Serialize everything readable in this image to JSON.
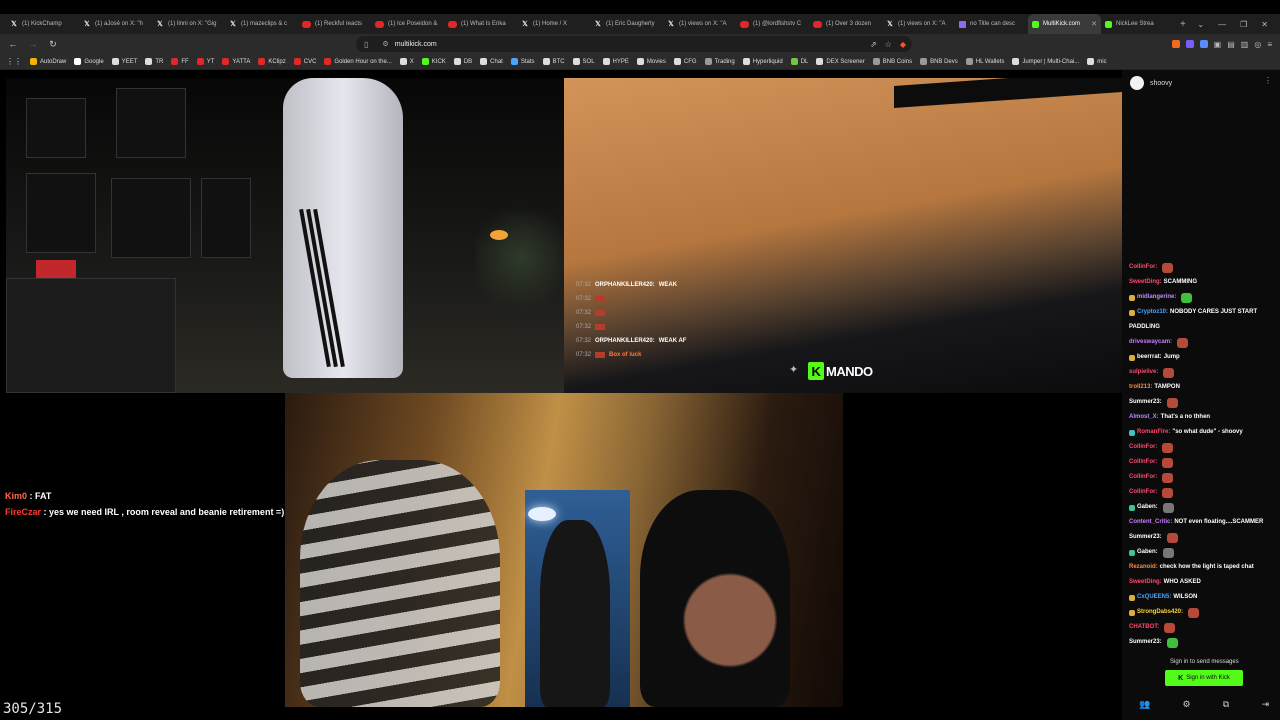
{
  "tabs": [
    {
      "icon": "x-icon",
      "label": "(1) KickChamp"
    },
    {
      "icon": "x-icon",
      "label": "(1) aJosé on X: \"h"
    },
    {
      "icon": "x-icon",
      "label": "(1) linni on X: \"Gig"
    },
    {
      "icon": "x-icon",
      "label": "(1) mazeclips & c"
    },
    {
      "icon": "youtube-icon",
      "label": "(1) Reckful reacts"
    },
    {
      "icon": "youtube-icon",
      "label": "(1) Ice Poseidon &"
    },
    {
      "icon": "youtube-icon",
      "label": "(1) What Is Erika"
    },
    {
      "icon": "x-icon",
      "label": "(1) Home / X"
    },
    {
      "icon": "x-icon",
      "label": "(1) Eric Daugherty"
    },
    {
      "icon": "x-icon",
      "label": "(1) views on X: \"A"
    },
    {
      "icon": "youtube-icon",
      "label": "(1) @lordfishstv C"
    },
    {
      "icon": "youtube-icon",
      "label": "(1) Over 3 dozen"
    },
    {
      "icon": "x-icon",
      "label": "(1) views on X: \"A"
    },
    {
      "icon": "doc-icon",
      "label": "no Title can desc"
    },
    {
      "icon": "kick-icon",
      "label": "MultiKick.com",
      "active": true
    },
    {
      "icon": "kick-icon",
      "label": "NickLee Strea"
    }
  ],
  "address": {
    "url": "multikick.com"
  },
  "bookmarks": [
    {
      "label": "AutoDraw",
      "color": "#f4b400"
    },
    {
      "label": "Google",
      "color": "#ffffff"
    },
    {
      "label": "YEET",
      "color": "#dddddd"
    },
    {
      "label": "TR",
      "color": "#dddddd"
    },
    {
      "label": "FF",
      "color": "#e02828"
    },
    {
      "label": "YT",
      "color": "#e02828"
    },
    {
      "label": "YATTA",
      "color": "#e02828"
    },
    {
      "label": "KClipz",
      "color": "#e02828"
    },
    {
      "label": "CVC",
      "color": "#e02828"
    },
    {
      "label": "Golden Hour on the...",
      "color": "#e02828"
    },
    {
      "label": "X",
      "color": "#dddddd"
    },
    {
      "label": "KICK",
      "color": "#53fc18"
    },
    {
      "label": "DB",
      "color": "#dddddd"
    },
    {
      "label": "Chat",
      "color": "#dddddd"
    },
    {
      "label": "Stats",
      "color": "#4aa3ff"
    },
    {
      "label": "BTC",
      "color": "#dddddd"
    },
    {
      "label": "SOL",
      "color": "#dddddd"
    },
    {
      "label": "HYPE",
      "color": "#dddddd"
    },
    {
      "label": "Movies",
      "color": "#dddddd"
    },
    {
      "label": "CFG",
      "color": "#dddddd"
    },
    {
      "label": "Trading",
      "color": "#999999"
    },
    {
      "label": "Hyperliquid",
      "color": "#dddddd"
    },
    {
      "label": "DL",
      "color": "#7bc142"
    },
    {
      "label": "DEX Screener",
      "color": "#dddddd"
    },
    {
      "label": "BNB Coins",
      "color": "#999999"
    },
    {
      "label": "BNB Devs",
      "color": "#999999"
    },
    {
      "label": "HL Wallets",
      "color": "#999999"
    },
    {
      "label": "Jumper | Multi-Chai...",
      "color": "#dddddd"
    },
    {
      "label": "mic",
      "color": "#dddddd"
    }
  ],
  "stream2_overlay": {
    "messages": [
      {
        "time": "07:32",
        "user": "ORPHANKILLER420:",
        "text": "WEAK",
        "color": "#ffffff"
      },
      {
        "time": "07:32",
        "user": "",
        "text": "",
        "color": "#b53b2a"
      },
      {
        "time": "07:32",
        "user": "",
        "text": "",
        "color": "#b53b2a"
      },
      {
        "time": "07:32",
        "user": "",
        "text": "",
        "color": "#b53b2a"
      },
      {
        "time": "07:32",
        "user": "ORPHANKILLER420:",
        "text": "WEAK AF",
        "color": "#ffffff"
      },
      {
        "time": "07:32",
        "user": "",
        "text": "Box of luck",
        "color": "#ff7a3d"
      }
    ],
    "logo": "MANDO"
  },
  "left_overlay": [
    {
      "user": "Kim0",
      "sep": " : ",
      "text": "FAT",
      "color": "#ff6a4f"
    },
    {
      "user": "FireCzar",
      "sep": " : ",
      "text": "yes we need IRL , room reveal and beanie retirement =)",
      "color": "#ff3b30"
    }
  ],
  "counter": "305/315",
  "chat_panel": {
    "channel": "shoovy",
    "messages": [
      {
        "user": "CollinFor:",
        "text": "",
        "color": "#ff4a6e",
        "emote": true
      },
      {
        "user": "SweetDing:",
        "text": "SCAMMING",
        "color": "#ff4a6e"
      },
      {
        "user": "midlangerine:",
        "text": "",
        "color": "#b690ff",
        "badge": "#d7b23a",
        "emote": true,
        "emoteColor": "#3fc13f"
      },
      {
        "user": "Cryptoz10:",
        "text": "NOBODY CARES JUST START",
        "color": "#4aa3ff",
        "badge": "#d7b23a"
      },
      {
        "user": "",
        "text": "PADDLING",
        "color": "#ffffff"
      },
      {
        "user": "driveswaycam:",
        "text": "",
        "color": "#c97eff",
        "emote": true
      },
      {
        "user": "beerrrat:",
        "text": "Jump",
        "color": "#ffffff",
        "badge": "#d7b23a"
      },
      {
        "user": "sulpielive:",
        "text": "",
        "color": "#ff4a6e",
        "emote": true
      },
      {
        "user": "troll213:",
        "text": "TAMPON",
        "color": "#ff8a3d"
      },
      {
        "user": "Summer23:",
        "text": "",
        "color": "#ffffff",
        "emote": true
      },
      {
        "user": "Almost_X:",
        "text": "That's a no thhen",
        "color": "#b690ff"
      },
      {
        "user": "RomanFire:",
        "text": "\"so what dude\" - shoovy",
        "color": "#ff4a6e",
        "badge": "#3fc1c1"
      },
      {
        "user": "CollinFor:",
        "text": "",
        "color": "#ff4a6e",
        "emote": true
      },
      {
        "user": "CollinFor:",
        "text": "",
        "color": "#ff4a6e",
        "emote": true
      },
      {
        "user": "CollinFor:",
        "text": "",
        "color": "#ff4a6e",
        "emote": true
      },
      {
        "user": "CollinFor:",
        "text": "",
        "color": "#ff4a6e",
        "emote": true
      },
      {
        "user": "Gaben:",
        "text": "",
        "color": "#ffffff",
        "badge": "#3fc1a0",
        "emote": true,
        "emoteColor": "#777777"
      },
      {
        "user": "Content_Critic:",
        "text": "NOT even floating....SCAMMER",
        "color": "#c97eff"
      },
      {
        "user": "Summer23:",
        "text": "",
        "color": "#ffffff",
        "emote": true
      },
      {
        "user": "Gaben:",
        "text": "",
        "color": "#ffffff",
        "badge": "#3fc1a0",
        "emote": true,
        "emoteColor": "#777777"
      },
      {
        "user": "Rezanoid:",
        "text": "check how the light is taped chat",
        "color": "#ff8a3d"
      },
      {
        "user": "SweetDing:",
        "text": "WHO ASKED",
        "color": "#ff4a6e"
      },
      {
        "user": "CxQUEEN5:",
        "text": "WILSON",
        "color": "#4aa3ff",
        "badge": "#d7b23a"
      },
      {
        "user": "StrongDabs420:",
        "text": "",
        "color": "#ffd23f",
        "badge": "#d7b23a",
        "emote": true
      },
      {
        "user": "CHATBOT:",
        "text": "",
        "color": "#ff4a6e",
        "emote": true
      },
      {
        "user": "Summer23:",
        "text": "",
        "color": "#ffffff",
        "emote": true,
        "emoteColor": "#3fc13f"
      }
    ],
    "signin_text": "Sign in to send messages",
    "signin_button": "Sign in with Kick"
  },
  "colors": {
    "kick_green": "#53fc18"
  }
}
